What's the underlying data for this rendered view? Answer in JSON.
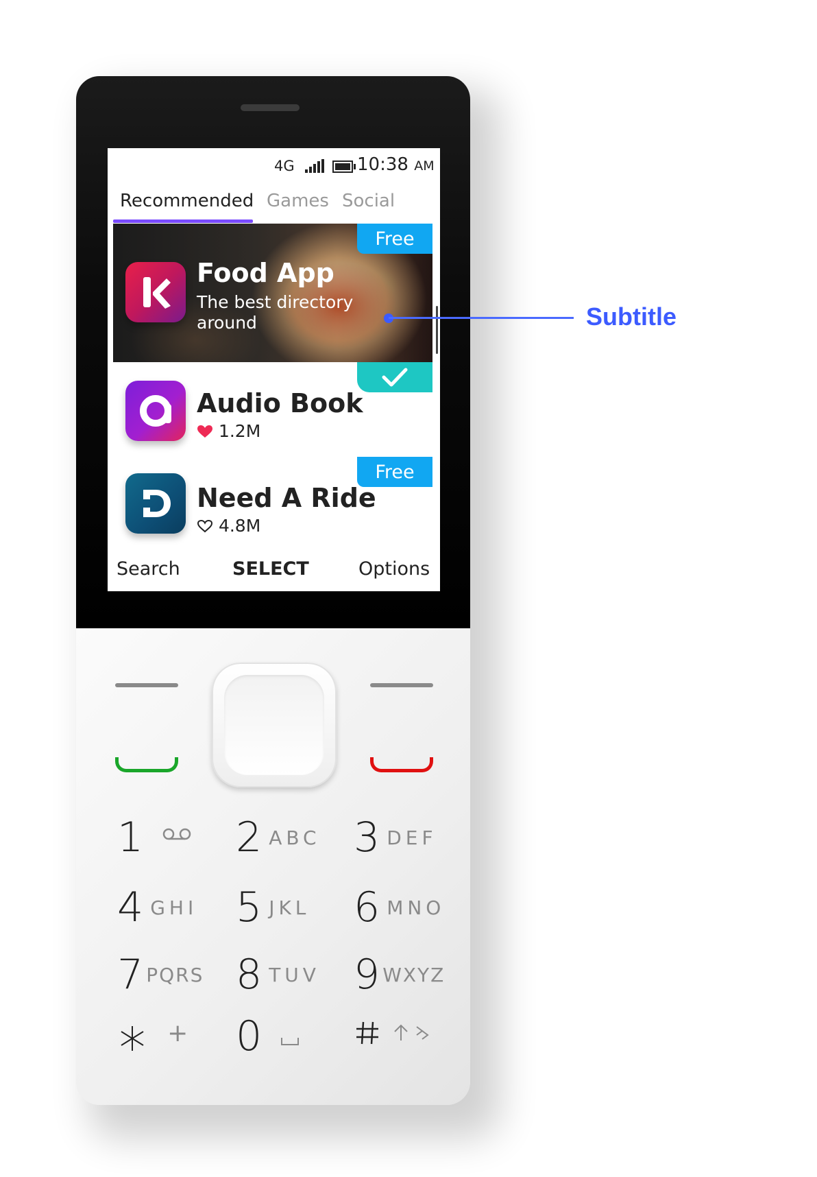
{
  "status_bar": {
    "network": "4G",
    "time": "10:38",
    "ampm": "AM"
  },
  "tabs": [
    {
      "label": "Recommended",
      "active": true
    },
    {
      "label": "Games",
      "active": false
    },
    {
      "label": "Social",
      "active": false
    }
  ],
  "items": [
    {
      "title": "Food App",
      "subtitle": "The best directory around",
      "badge": "Free",
      "icon": "k-logo-icon"
    },
    {
      "title": "Audio Book",
      "meta": "1.2M",
      "liked": true,
      "badge_icon": "checkmark-icon",
      "icon": "a-logo-icon"
    },
    {
      "title": "Need A Ride",
      "meta": "4.8M",
      "liked": false,
      "badge": "Free",
      "icon": "d-logo-icon"
    }
  ],
  "softkeys": {
    "left": "Search",
    "center": "SELECT",
    "right": "Options"
  },
  "keypad": [
    {
      "digit": "1",
      "letters": "voicemail-icon"
    },
    {
      "digit": "2",
      "letters": "ABC"
    },
    {
      "digit": "3",
      "letters": "DEF"
    },
    {
      "digit": "4",
      "letters": "GHI"
    },
    {
      "digit": "5",
      "letters": "JKL"
    },
    {
      "digit": "6",
      "letters": "MNO"
    },
    {
      "digit": "7",
      "letters": "PQRS"
    },
    {
      "digit": "8",
      "letters": "TUV"
    },
    {
      "digit": "9",
      "letters": "WXYZ"
    },
    {
      "digit": "*",
      "letters": "+"
    },
    {
      "digit": "0",
      "letters": "space-icon"
    },
    {
      "digit": "#",
      "letters": "shift-icon"
    }
  ],
  "annotation": {
    "label": "Subtitle",
    "color": "#3c5bff"
  },
  "colors": {
    "tab_underline": "#7a4bff",
    "badge_free": "#11a7f2",
    "badge_check": "#1ec7c3",
    "call_green": "#1aa62a",
    "call_red": "#e01010"
  }
}
